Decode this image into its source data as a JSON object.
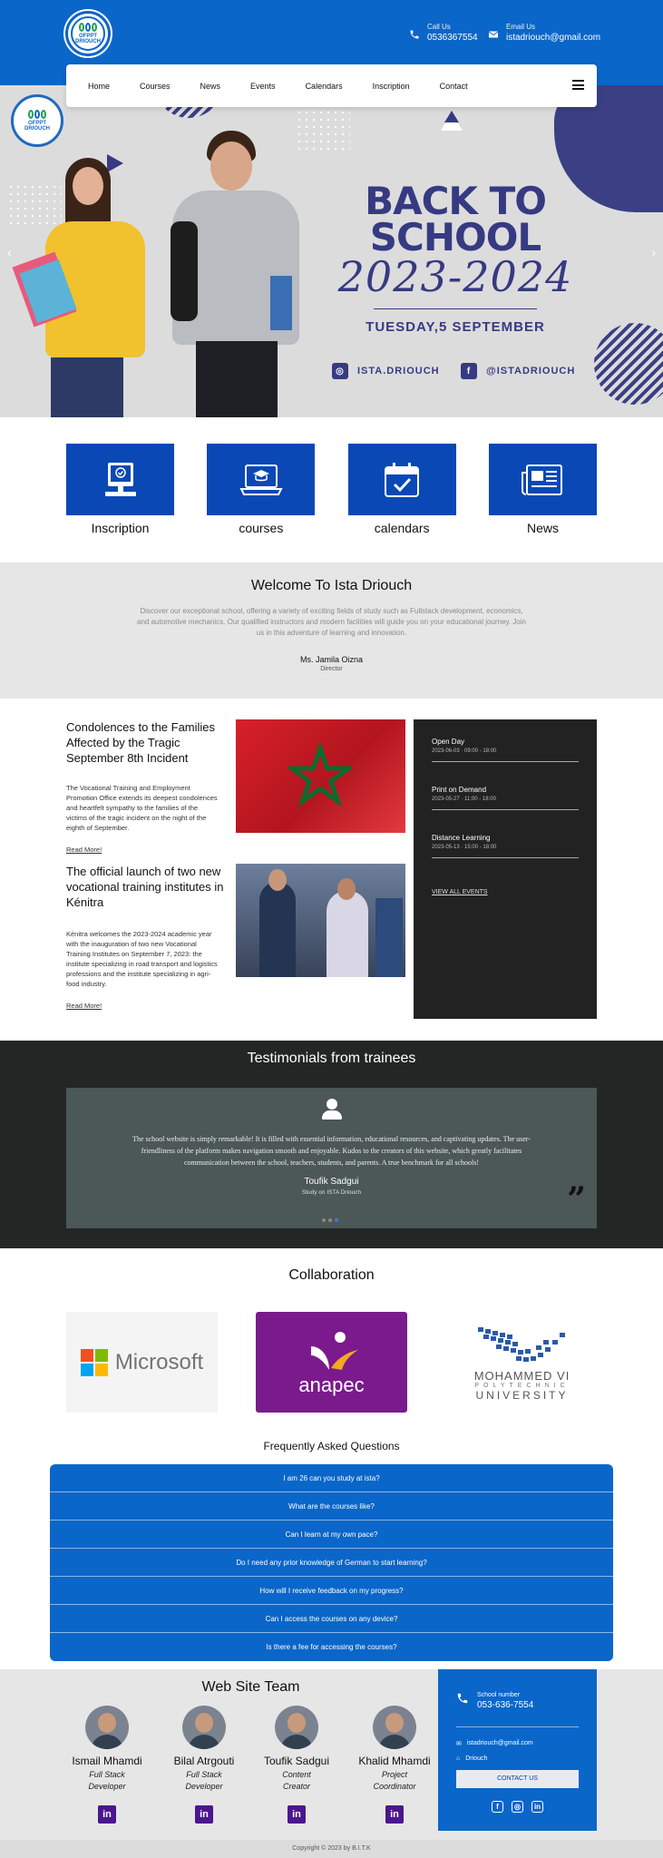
{
  "header": {
    "logo_text": "OFPPT",
    "logo_sub": "DRIOUCH",
    "phone_label": "Call Us",
    "phone": "0536367554",
    "email_label": "Email Us",
    "email": "istadriouch@gmail.com"
  },
  "nav": {
    "items": [
      "Home",
      "Courses",
      "News",
      "Events",
      "Calendars",
      "Inscription",
      "Contact"
    ],
    "menu_icon": "hamburger-icon"
  },
  "hero": {
    "title_line1": "BACK TO",
    "title_line2": "SCHOOL",
    "year": "2023-2024",
    "date": "TUESDAY,5 SEPTEMBER",
    "instagram": "ISTA.DRIOUCH",
    "facebook": "@ISTADRIOUCH",
    "logo_text": "OFPPT",
    "logo_sub": "DRIOUCH",
    "prev": "‹",
    "next": "›"
  },
  "quick_links": [
    {
      "label": "Inscription",
      "icon": "computer-check-icon"
    },
    {
      "label": "courses",
      "icon": "laptop-graduation-icon"
    },
    {
      "label": "calendars",
      "icon": "calendar-check-icon"
    },
    {
      "label": "News",
      "icon": "newspaper-icon"
    }
  ],
  "welcome": {
    "title": "Welcome To Ista Driouch",
    "text": "Discover our exceptional school, offering a variety of exciting fields of study such as Fullstack development, economics, and automotive mechanics. Our qualified instructors and modern facilities will guide you on your educational journey. Join us in this adventure of learning and innovation.",
    "name": "Ms. Jamila Oizna",
    "role": "Director"
  },
  "news": [
    {
      "title": "Condolences to the Families Affected by the Tragic September 8th Incident",
      "text": "The Vocational Training and Employment Promotion Office extends its deepest condolences and heartfelt sympathy to the families of the victims of the tragic incident on the night of the eighth of September.",
      "more": "Read More!"
    },
    {
      "title": "The official launch of two new vocational training institutes in Kénitra",
      "text": "Kénitra welcomes the 2023-2024 academic year with the inauguration of two new Vocational Training Institutes on September 7, 2023: the institute specializing in road transport and logistics professions and the institute specializing in agri-food industry.",
      "more": "Read More!"
    }
  ],
  "events": {
    "items": [
      {
        "title": "Open Day",
        "date": "2023-06-03 · 09:00 - 18:00"
      },
      {
        "title": "Print on Demand",
        "date": "2023-05-27 · 11:00 - 18:00"
      },
      {
        "title": "Distance Learning",
        "date": "2023-05-13 · 15:00 - 18:00"
      }
    ],
    "view_all": "VIEW ALL EVENTS"
  },
  "testimonials": {
    "title": "Testimonials from trainees",
    "text": "The school website is simply remarkable! It is filled with essential information, educational resources, and captivating updates. The user-friendliness of the platform makes navigation smooth and enjoyable. Kudos to the creators of this website, which greatly facilitates communication between the school, teachers, students, and parents. A true benchmark for all schools!",
    "name": "Toufik Sadgui",
    "role": "Study on ISTA Driouch",
    "prev": "‹",
    "next": "›"
  },
  "collaboration": {
    "title": "Collaboration",
    "microsoft": "Microsoft",
    "anapec": "anapec",
    "um6p_line1": "MOHAMMED VI",
    "um6p_line2": "POLYTECHNIC",
    "um6p_line3": "UNIVERSITY"
  },
  "faq": {
    "title": "Frequently Asked Questions",
    "items": [
      "I am 26 can you study at ista?",
      "What are the courses like?",
      "Can I learn at my own pace?",
      "Do I need any prior knowledge of German to start learning?",
      "How will I receive feedback on my progress?",
      "Can I access the courses on any device?",
      "Is there a fee for accessing the courses?"
    ]
  },
  "team": {
    "title": "Web Site Team",
    "members": [
      {
        "name": "Ismail Mhamdi",
        "role1": "Full Stack",
        "role2": "Developer"
      },
      {
        "name": "Bilal Atrgouti",
        "role1": "Full Stack",
        "role2": "Developer"
      },
      {
        "name": "Toufik Sadgui",
        "role1": "Content",
        "role2": "Creator"
      },
      {
        "name": "Khalid Mhamdi",
        "role1": "Project",
        "role2": "Coordinator"
      }
    ]
  },
  "footer_box": {
    "phone_label": "School number",
    "phone": "053-636-7554",
    "email": "istadriouch@gmail.com",
    "location": "Driouch",
    "button": "CONTACT US"
  },
  "copyright": "Copyright © 2023 by B.I.T.K",
  "colors": {
    "primary": "#0a66c9",
    "navy": "#363a82",
    "dark": "#222222",
    "testimonial_bg": "#222726"
  }
}
